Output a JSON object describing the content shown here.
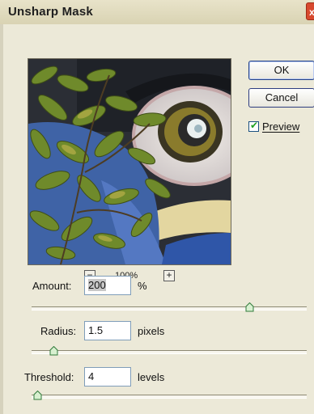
{
  "dialog": {
    "title": "Unsharp Mask",
    "close_label": "x"
  },
  "buttons": {
    "ok": "OK",
    "cancel": "Cancel"
  },
  "preview_checkbox": {
    "label": "Preview",
    "checked": true
  },
  "zoom": {
    "out_label": "−",
    "level": "100%",
    "in_label": "+"
  },
  "fields": {
    "amount": {
      "label": "Amount:",
      "value": "200",
      "unit": "%",
      "slider_fraction": 0.79
    },
    "radius": {
      "label": "Radius:",
      "value": "1.5",
      "unit": "pixels",
      "slider_fraction": 0.08
    },
    "threshold": {
      "label": "Threshold:",
      "value": "4",
      "unit": "levels",
      "slider_fraction": 0.02
    }
  },
  "colors": {
    "dialog_bg": "#ece9d8",
    "ok_border": "#234289",
    "checkmark": "#21a121"
  },
  "icons": {
    "close": "close-icon",
    "zoom_out": "zoom-out-icon",
    "zoom_in": "zoom-in-icon",
    "check": "checkmark-icon"
  }
}
